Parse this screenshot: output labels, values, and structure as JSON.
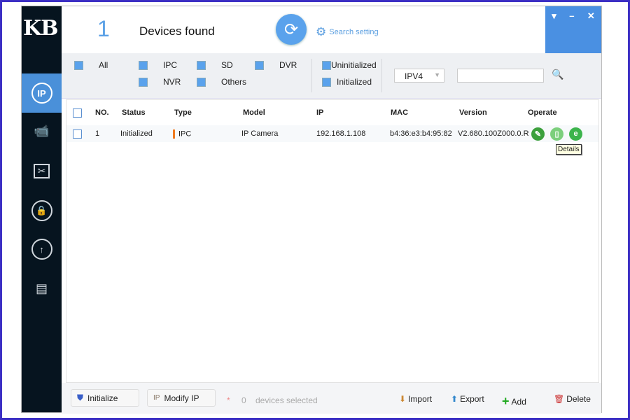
{
  "app": {
    "logo": "KB",
    "device_count": "1",
    "devices_found_label": "Devices found",
    "search_setting": "Search setting",
    "accent": "#4a90e2"
  },
  "window_controls": {
    "dropdown": "▾",
    "minimize": "–",
    "close": "✕"
  },
  "sidebar": {
    "items": [
      {
        "icon": "ip-icon",
        "label": "IP",
        "active": true
      },
      {
        "icon": "camera-icon"
      },
      {
        "icon": "tools-icon"
      },
      {
        "icon": "lock-icon"
      },
      {
        "icon": "upgrade-icon"
      },
      {
        "icon": "document-icon"
      }
    ]
  },
  "filters": {
    "all": "All",
    "ipc": "IPC",
    "sd": "SD",
    "dvr": "DVR",
    "nvr": "NVR",
    "others": "Others",
    "uninitialized": "Uninitialized",
    "initialized": "Initialized",
    "ip_version": "IPV4",
    "search_value": ""
  },
  "table": {
    "headers": [
      "NO.",
      "Status",
      "Type",
      "Model",
      "IP",
      "MAC",
      "Version",
      "Operate"
    ],
    "rows": [
      {
        "no": "1",
        "status": "Initialized",
        "type": "IPC",
        "model": "IP Camera",
        "ip": "192.168.1.108",
        "mac": "b4:36:e3:b4:95:82",
        "version": "V2.680.100Z000.0.R"
      }
    ],
    "tooltip": "Details"
  },
  "footer": {
    "initialize": "Initialize",
    "modify_ip": "Modify IP",
    "star": "*",
    "selected_count": "0",
    "selected_label": "devices selected",
    "import": "Import",
    "export": "Export",
    "add": "Add",
    "delete": "Delete"
  }
}
